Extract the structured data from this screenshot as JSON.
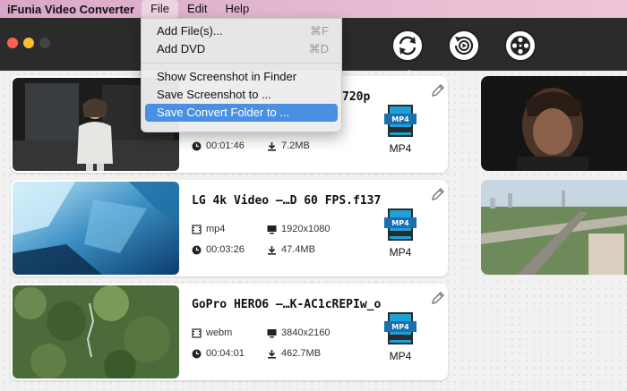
{
  "menubar": {
    "app_name": "iFunia Video Converter",
    "menus": [
      "File",
      "Edit",
      "Help"
    ]
  },
  "file_menu": {
    "items": [
      {
        "label": "Add File(s)...",
        "shortcut": "⌘F"
      },
      {
        "label": "Add DVD",
        "shortcut": "⌘D"
      },
      {
        "label": "Show Screenshot in Finder",
        "shortcut": ""
      },
      {
        "label": "Save Screenshot to ...",
        "shortcut": ""
      },
      {
        "label": "Save Convert Folder to ...",
        "shortcut": ""
      }
    ]
  },
  "toolbar": {
    "icons": [
      "convert-icon",
      "rotate-icon",
      "media-icon"
    ]
  },
  "videos": [
    {
      "name": "720p",
      "format": "",
      "resolution": "",
      "duration": "00:01:46",
      "size": "7.2MB",
      "output_format": "MP4"
    },
    {
      "name": "LG 4k Video —…D 60 FPS.f137",
      "format": "mp4",
      "resolution": "1920x1080",
      "duration": "00:03:26",
      "size": "47.4MB",
      "output_format": "MP4"
    },
    {
      "name": "GoPro HERO6 —…K-AC1cREPIw_o",
      "format": "webm",
      "resolution": "3840x2160",
      "duration": "00:04:01",
      "size": "462.7MB",
      "output_format": "MP4"
    }
  ],
  "colors": {
    "highlight": "#4a90e2",
    "toolbar": "#2b2b2b"
  }
}
